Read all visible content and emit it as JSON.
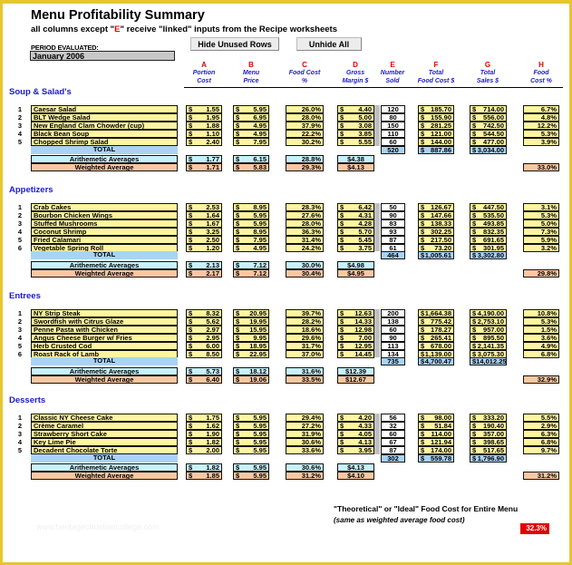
{
  "header": {
    "title": "Menu Profitability Summary",
    "subtitle_pre": "all columns except \"",
    "subtitle_letter": "E",
    "subtitle_post": "\" receive \"linked\" inputs from the Recipe worksheets",
    "period_label": "PERIOD EVALUATED:",
    "period_value": "January 2006"
  },
  "buttons": {
    "hide_unused_rows": "Hide Unused Rows",
    "unhide_all": "Unhide All"
  },
  "columns": [
    {
      "letter": "A",
      "line1": "Portion",
      "line2": "Cost"
    },
    {
      "letter": "B",
      "line1": "Menu",
      "line2": "Price"
    },
    {
      "letter": "C",
      "line1": "Food Cost",
      "line2": "%"
    },
    {
      "letter": "D",
      "line1": "Gross",
      "line2": "Margin $"
    },
    {
      "letter": "E",
      "line1": "Number",
      "line2": "Sold"
    },
    {
      "letter": "F",
      "line1": "Total",
      "line2": "Food Cost $"
    },
    {
      "letter": "G",
      "line1": "Total",
      "line2": "Sales $"
    },
    {
      "letter": "H",
      "line1": "Food",
      "line2": "Cost %"
    }
  ],
  "labels": {
    "total": "TOTAL",
    "arith": "Arithemetic Averages",
    "weighted": "Weighted Average",
    "currency": "$"
  },
  "sections": [
    {
      "title": "Soup & Salad's",
      "items": [
        {
          "n": "1",
          "name": "Caesar Salad",
          "a": "1.55",
          "b": "5.95",
          "c": "26.0%",
          "d": "4.40",
          "e": "120",
          "f": "185.70",
          "g": "714.00",
          "h": "6.7%"
        },
        {
          "n": "2",
          "name": "BLT Wedge Salad",
          "a": "1.95",
          "b": "6.95",
          "c": "28.0%",
          "d": "5.00",
          "e": "80",
          "f": "155.90",
          "g": "556.00",
          "h": "4.8%"
        },
        {
          "n": "3",
          "name": "New England Clam Chowder (cup)",
          "a": "1.88",
          "b": "4.95",
          "c": "37.9%",
          "d": "3.08",
          "e": "150",
          "f": "281.25",
          "g": "742.50",
          "h": "12.2%"
        },
        {
          "n": "4",
          "name": "Black Bean Soup",
          "a": "1.10",
          "b": "4.95",
          "c": "22.2%",
          "d": "3.85",
          "e": "110",
          "f": "121.00",
          "g": "544.50",
          "h": "5.3%"
        },
        {
          "n": "5",
          "name": "Chopped Shrimp Salad",
          "a": "2.40",
          "b": "7.95",
          "c": "30.2%",
          "d": "5.55",
          "e": "60",
          "f": "144.00",
          "g": "477.00",
          "h": "3.9%"
        }
      ],
      "total": {
        "e": "520",
        "f": "887.86",
        "g": "3,034.00"
      },
      "arith": {
        "a": "1.77",
        "b": "6.15",
        "c": "28.8%",
        "d": "$4.38"
      },
      "weighted": {
        "a": "1.71",
        "b": "5.83",
        "c": "29.3%",
        "d": "$4.13",
        "h": "33.0%"
      }
    },
    {
      "title": "Appetizers",
      "items": [
        {
          "n": "1",
          "name": "Crab Cakes",
          "a": "2.53",
          "b": "8.95",
          "c": "28.3%",
          "d": "6.42",
          "e": "50",
          "f": "126.67",
          "g": "447.50",
          "h": "3.1%"
        },
        {
          "n": "2",
          "name": "Bourbon Chicken Wings",
          "a": "1.64",
          "b": "5.95",
          "c": "27.6%",
          "d": "4.31",
          "e": "90",
          "f": "147.66",
          "g": "535.50",
          "h": "5.3%"
        },
        {
          "n": "3",
          "name": "Stuffed Mushrooms",
          "a": "1.67",
          "b": "5.95",
          "c": "28.0%",
          "d": "4.28",
          "e": "83",
          "f": "138.33",
          "g": "493.85",
          "h": "5.0%"
        },
        {
          "n": "4",
          "name": "Coconut Shrimp",
          "a": "3.25",
          "b": "8.95",
          "c": "36.3%",
          "d": "5.70",
          "e": "93",
          "f": "302.25",
          "g": "832.35",
          "h": "7.3%"
        },
        {
          "n": "5",
          "name": "Fried Calamari",
          "a": "2.50",
          "b": "7.95",
          "c": "31.4%",
          "d": "5.45",
          "e": "87",
          "f": "217.50",
          "g": "691.65",
          "h": "5.9%"
        },
        {
          "n": "6",
          "name": "Vegetable Spring Roll",
          "a": "1.20",
          "b": "4.95",
          "c": "24.2%",
          "d": "3.75",
          "e": "61",
          "f": "73.20",
          "g": "301.95",
          "h": "3.2%"
        }
      ],
      "total": {
        "e": "464",
        "f": "1,005.61",
        "g": "3,302.80"
      },
      "arith": {
        "a": "2.13",
        "b": "7.12",
        "c": "30.0%",
        "d": "$4.98"
      },
      "weighted": {
        "a": "2.17",
        "b": "7.12",
        "c": "30.4%",
        "d": "$4.95",
        "h": "29.8%"
      }
    },
    {
      "title": "Entrees",
      "items": [
        {
          "n": "1",
          "name": "NY Strip Steak",
          "a": "8.32",
          "b": "20.95",
          "c": "39.7%",
          "d": "12.63",
          "e": "200",
          "f": "1,664.38",
          "g": "4,190.00",
          "h": "10.8%"
        },
        {
          "n": "2",
          "name": "Swordfish with Citrus Glaze",
          "a": "5.62",
          "b": "19.95",
          "c": "28.2%",
          "d": "14.33",
          "e": "138",
          "f": "775.42",
          "g": "2,753.10",
          "h": "5.3%"
        },
        {
          "n": "3",
          "name": "Penne Pasta with Chicken",
          "a": "2.97",
          "b": "15.95",
          "c": "18.6%",
          "d": "12.98",
          "e": "60",
          "f": "178.27",
          "g": "957.00",
          "h": "1.5%"
        },
        {
          "n": "4",
          "name": "Angus Cheese Burger w/ Fries",
          "a": "2.95",
          "b": "9.95",
          "c": "29.6%",
          "d": "7.00",
          "e": "90",
          "f": "265.41",
          "g": "895.50",
          "h": "3.6%"
        },
        {
          "n": "5",
          "name": "Herb Crusted Cod",
          "a": "6.00",
          "b": "18.95",
          "c": "31.7%",
          "d": "12.95",
          "e": "113",
          "f": "678.00",
          "g": "2,141.35",
          "h": "4.9%"
        },
        {
          "n": "6",
          "name": "Roast Rack of Lamb",
          "a": "8.50",
          "b": "22.95",
          "c": "37.0%",
          "d": "14.45",
          "e": "134",
          "f": "1,139.00",
          "g": "3,075.30",
          "h": "6.8%"
        }
      ],
      "total": {
        "e": "735",
        "f": "4,700.47",
        "g": "14,012.25"
      },
      "arith": {
        "a": "5.73",
        "b": "18.12",
        "c": "31.6%",
        "d": "$12.39"
      },
      "weighted": {
        "a": "6.40",
        "b": "19.06",
        "c": "33.5%",
        "d": "$12.67",
        "h": "32.9%"
      }
    },
    {
      "title": "Desserts",
      "items": [
        {
          "n": "1",
          "name": "Classic NY Cheese Cake",
          "a": "1.75",
          "b": "5.95",
          "c": "29.4%",
          "d": "4.20",
          "e": "56",
          "f": "98.00",
          "g": "333.20",
          "h": "5.5%"
        },
        {
          "n": "2",
          "name": "Crème Caramel",
          "a": "1.62",
          "b": "5.95",
          "c": "27.2%",
          "d": "4.33",
          "e": "32",
          "f": "51.84",
          "g": "190.40",
          "h": "2.9%"
        },
        {
          "n": "3",
          "name": "Strawberry Short Cake",
          "a": "1.90",
          "b": "5.95",
          "c": "31.9%",
          "d": "4.05",
          "e": "60",
          "f": "114.00",
          "g": "357.00",
          "h": "6.3%"
        },
        {
          "n": "4",
          "name": "Key Lime Pie",
          "a": "1.82",
          "b": "5.95",
          "c": "30.6%",
          "d": "4.13",
          "e": "67",
          "f": "121.94",
          "g": "398.65",
          "h": "6.8%"
        },
        {
          "n": "5",
          "name": "Decadent Chocolate Torte",
          "a": "2.00",
          "b": "5.95",
          "c": "33.6%",
          "d": "3.95",
          "e": "87",
          "f": "174.00",
          "g": "517.65",
          "h": "9.7%"
        }
      ],
      "total": {
        "e": "302",
        "f": "559.78",
        "g": "1,796.90"
      },
      "arith": {
        "a": "1.82",
        "b": "5.95",
        "c": "30.6%",
        "d": "$4.13"
      },
      "weighted": {
        "a": "1.85",
        "b": "5.95",
        "c": "31.2%",
        "d": "$4.10",
        "h": "31.2%"
      }
    }
  ],
  "footer": {
    "theoretical_label": "\"Theoretical\" or \"Ideal\" Food Cost for Entire Menu",
    "theoretical_sub": "(same as weighted average food cost)",
    "theoretical_value": "32.3%",
    "watermark": "www.heritagechristiancollege.com"
  },
  "colors": {
    "frame": "#e6c62f",
    "input_yellow": "#fff5a0",
    "total_blue": "#a9d3f5",
    "arith_lightblue": "#c8f2fb",
    "weighted_orange": "#f9c8a0",
    "accent_red": "#e00000",
    "header_blue": "#1a1acc"
  }
}
